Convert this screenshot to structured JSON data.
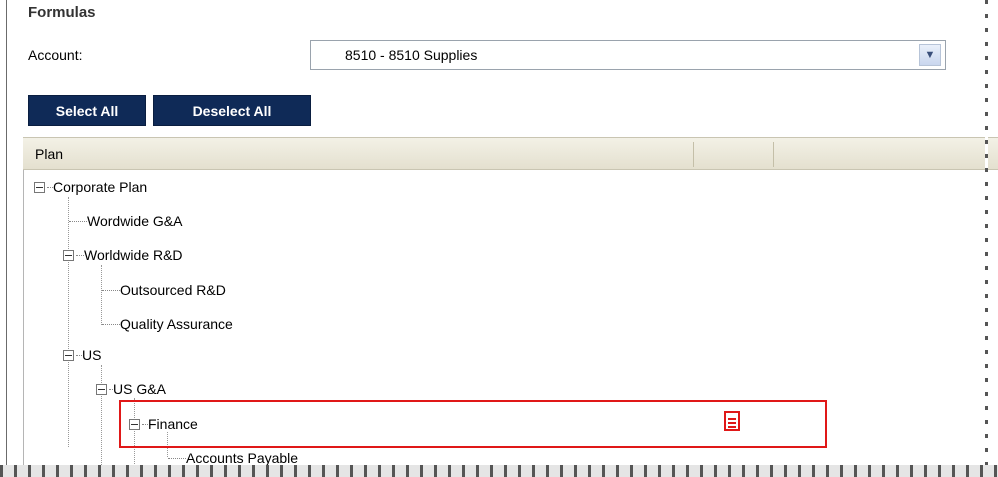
{
  "section": {
    "title": "Formulas"
  },
  "account": {
    "label": "Account:",
    "value": "8510 - 8510 Supplies"
  },
  "buttons": {
    "select_all": "Select All",
    "deselect_all": "Deselect All"
  },
  "grid": {
    "columns": [
      "Plan",
      "",
      ""
    ]
  },
  "tree": [
    {
      "label": "Corporate Plan",
      "expanded": true,
      "depth": 0
    },
    {
      "label": "Wordwide G&A",
      "expanded": null,
      "depth": 1
    },
    {
      "label": "Worldwide R&D",
      "expanded": true,
      "depth": 1
    },
    {
      "label": "Outsourced R&D",
      "expanded": null,
      "depth": 2
    },
    {
      "label": "Quality Assurance",
      "expanded": null,
      "depth": 2
    },
    {
      "label": "US",
      "expanded": true,
      "depth": 1
    },
    {
      "label": "US G&A",
      "expanded": true,
      "depth": 2
    },
    {
      "label": "Finance",
      "expanded": true,
      "depth": 3
    },
    {
      "label": "Accounts Payable",
      "expanded": null,
      "depth": 4
    }
  ],
  "highlight": {
    "color": "#e01818"
  },
  "colors": {
    "button_bg": "#0f2a57",
    "header_bg": "#e4e0cf"
  }
}
